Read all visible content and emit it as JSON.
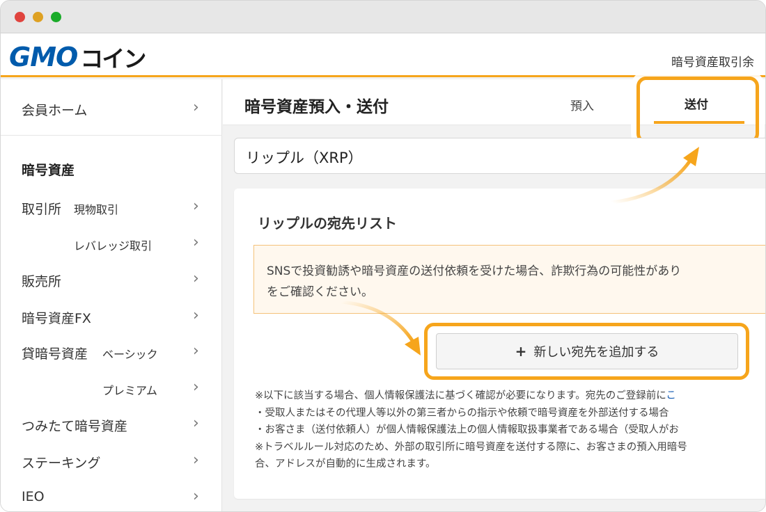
{
  "header": {
    "logo_gmo": "GMO",
    "logo_coin": "コイン",
    "right_text": "暗号資産取引余"
  },
  "sidebar": {
    "member_home": "会員ホーム",
    "heading": "暗号資産",
    "exchange": "取引所",
    "exchange_spot": "現物取引",
    "exchange_leverage": "レバレッジ取引",
    "sales": "販売所",
    "fx": "暗号資産FX",
    "lending": "貸暗号資産",
    "lending_basic": "ベーシック",
    "lending_premium": "プレミアム",
    "tsumitate": "つみたて暗号資産",
    "staking": "ステーキング",
    "ieo": "IEO",
    "chevron": "›"
  },
  "main": {
    "page_title": "暗号資産預入・送付",
    "tab_deposit": "預入",
    "tab_send": "送付",
    "coin_select_value": "リップル（XRP）",
    "card_title": "リップルの宛先リスト",
    "notice_line1": "SNSで投資勧誘や暗号資産の送付依頼を受けた場合、詐欺行為の可能性があり",
    "notice_line2": "をご確認ください。",
    "add_button_plus": "+",
    "add_button_label": "新しい宛先を追加する",
    "note1": "※以下に該当する場合、個人情報保護法に基づく確認が必要になります。宛先のご登録前に",
    "note1_link": "こ",
    "note2": "・受取人またはその代理人等以外の第三者からの指示や依頼で暗号資産を外部送付する場合",
    "note3": "・お客さま（送付依頼人）が個人情報保護法上の個人情報取扱事業者である場合（受取人がお",
    "note4": "※トラベルルール対応のため、外部の取引所に暗号資産を送付する際に、お客さまの預入用暗号",
    "note5": "合、アドレスが自動的に生成されます。"
  },
  "colors": {
    "accent_orange": "#f6a51c",
    "brand_blue": "#005bac",
    "link_blue": "#1a5fb4"
  }
}
